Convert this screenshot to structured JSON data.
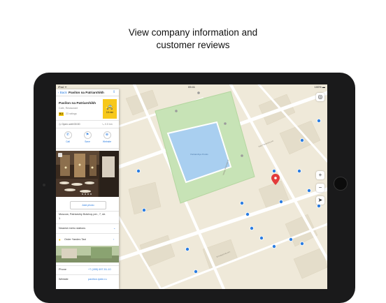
{
  "headline": {
    "line1": "View company information and",
    "line2": "customer reviews"
  },
  "status_bar": {
    "left": "iPad ᯤ",
    "time": "09:41",
    "right": "100% ▬"
  },
  "panel": {
    "back_label": "‹ Back",
    "title": "Pavilon na Patriarshikh",
    "share_icon": "share-icon",
    "name": "Pavilon na Patriarshikh",
    "category": "Cafe, Restaurant",
    "rating": "8.1",
    "ratings_count": "23 ratings",
    "taxi_time": "15 min",
    "open_until": "Open until 00:00",
    "distance": "0.5 km",
    "actions": [
      {
        "label": "Call",
        "icon": "phone-icon"
      },
      {
        "label": "Save",
        "icon": "bookmark-icon"
      },
      {
        "label": "Website",
        "icon": "globe-icon"
      }
    ],
    "add_photo": "Add photo",
    "address_1": "Moscow, Patriarshiy Bolshoy per., 7, str.",
    "address_2": "1",
    "metro": "Nearest metro stations",
    "order_taxi": "Order Yandex.Taxi",
    "phone_label": "Phone",
    "phone_value": "+7 (495) 697-51-10",
    "website_label": "Website",
    "website_value": "pavilion.ipdm.ru"
  },
  "map": {
    "pond_label": "Patriarshiye Ponds",
    "controls": {
      "zoom_in": "+",
      "zoom_out": "−",
      "locate": "➤"
    },
    "colors": {
      "land": "#efe9d9",
      "park": "#c7e3b6",
      "water": "#a9cff0",
      "road": "#ffffff",
      "poi": "#2b7de1",
      "pin": "#e33b3b",
      "building": "#e4ddca"
    }
  }
}
